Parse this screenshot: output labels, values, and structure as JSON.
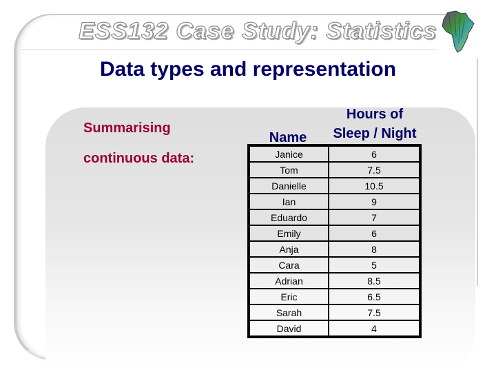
{
  "header": {
    "course_title": "ESS132 Case Study: Statistics",
    "logo_icon": "africa-map-icon"
  },
  "slide": {
    "title": "Data types and representation",
    "subtitle_line1": "Summarising",
    "subtitle_line2": "continuous data:"
  },
  "table": {
    "columns": [
      "Name",
      "Hours of Sleep / Night"
    ],
    "column_hours_line1": "Hours of",
    "column_hours_line2": "Sleep / Night",
    "rows": [
      {
        "name": "Janice",
        "hours": "6"
      },
      {
        "name": "Tom",
        "hours": "7.5"
      },
      {
        "name": "Danielle",
        "hours": "10.5"
      },
      {
        "name": "Ian",
        "hours": "9"
      },
      {
        "name": "Eduardo",
        "hours": "7"
      },
      {
        "name": "Emily",
        "hours": "6"
      },
      {
        "name": "Anja",
        "hours": "8"
      },
      {
        "name": "Cara",
        "hours": "5"
      },
      {
        "name": "Adrian",
        "hours": "8.5"
      },
      {
        "name": "Eric",
        "hours": "6.5"
      },
      {
        "name": "Sarah",
        "hours": "7.5"
      },
      {
        "name": "David",
        "hours": "4"
      }
    ]
  },
  "colors": {
    "title": "#000066",
    "subtitle": "#990033",
    "panel": "#dedede"
  }
}
